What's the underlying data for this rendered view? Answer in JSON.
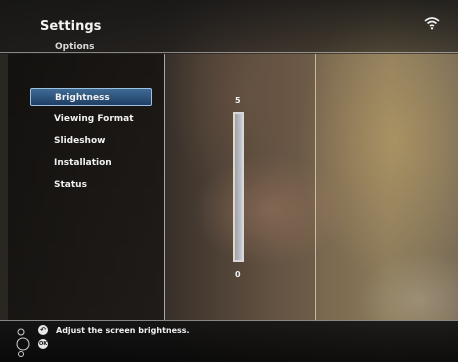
{
  "header": {
    "title": "Settings",
    "subtitle": "Options",
    "wifi_icon": "wifi-icon"
  },
  "menu": {
    "items": [
      {
        "label": "Brightness",
        "selected": true
      },
      {
        "label": "Viewing Format",
        "selected": false
      },
      {
        "label": "Slideshow",
        "selected": false
      },
      {
        "label": "Installation",
        "selected": false
      },
      {
        "label": "Status",
        "selected": false
      }
    ]
  },
  "slider": {
    "max_label": "5",
    "min_label": "0",
    "level_fraction": 1.0
  },
  "footer": {
    "help_text": "Adjust the screen brightness.",
    "icons": [
      "back-button-icon",
      "ok-button-icon",
      "navigation-pad-icon"
    ]
  },
  "colors": {
    "selection": "#2f5680",
    "selection_border": "#9cc0e0"
  }
}
